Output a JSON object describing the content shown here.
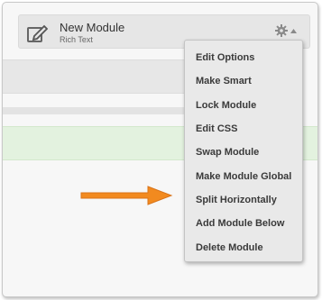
{
  "module": {
    "title": "New Module",
    "subtitle": "Rich Text"
  },
  "menu": {
    "items": [
      "Edit Options",
      "Make Smart",
      "Lock Module",
      "Edit CSS",
      "Swap Module",
      "Make Module Global",
      "Split Horizontally",
      "Add Module Below",
      "Delete Module"
    ]
  },
  "icons": {
    "edit": "pencil-square-icon",
    "settings": "gear-icon",
    "dropdown": "caret-up-icon",
    "annotation": "orange-arrow"
  },
  "colors": {
    "arrow": "#f28a1f",
    "success_band": "#e3f2df",
    "menu_bg": "#e9e9e9"
  }
}
